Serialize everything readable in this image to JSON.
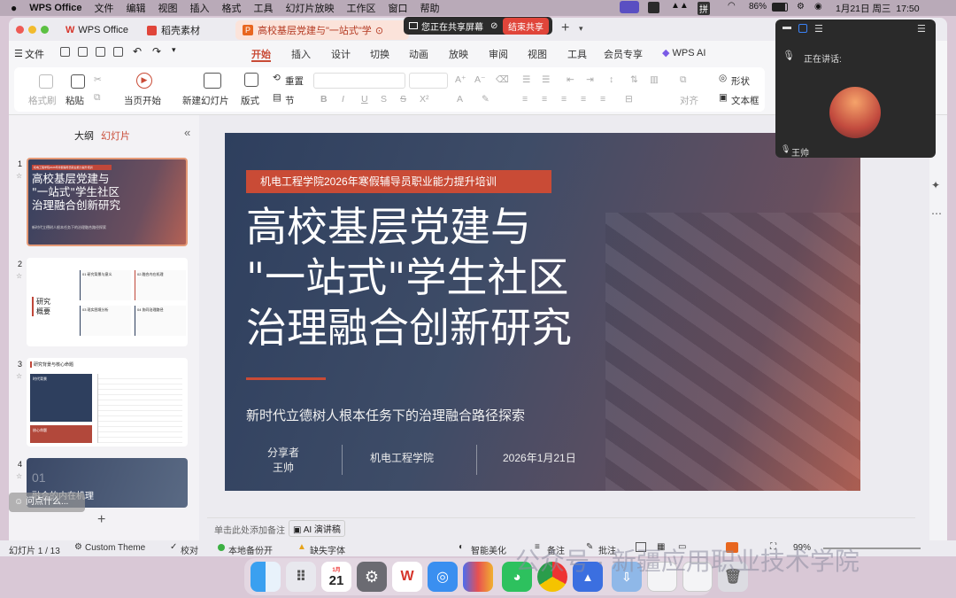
{
  "menubar": {
    "app": "WPS Office",
    "items": [
      "文件",
      "编辑",
      "视图",
      "插入",
      "格式",
      "工具",
      "幻灯片放映",
      "工作区",
      "窗口",
      "帮助"
    ],
    "ime": "拼",
    "battery": "86%",
    "datetime": "1月21日 周三  17:50"
  },
  "share_bar": {
    "text": "您正在共享屏幕",
    "stop": "结束共享"
  },
  "tabs": [
    {
      "label": "WPS Office"
    },
    {
      "label": "稻壳素材"
    },
    {
      "label": "高校基层党建与\"一站式\"学"
    }
  ],
  "ribbon": {
    "file": "文件",
    "tabs": [
      "开始",
      "插入",
      "设计",
      "切换",
      "动画",
      "放映",
      "审阅",
      "视图",
      "工具",
      "会员专享",
      "WPS AI"
    ],
    "active_tab": "开始",
    "tools": {
      "format_painter": "格式刷",
      "paste": "粘贴",
      "from_current": "当页开始",
      "new_slide": "新建幻灯片",
      "layout": "版式",
      "reset": "重置",
      "section": "节",
      "align": "对齐",
      "shape": "形状",
      "textbox": "文本框"
    }
  },
  "sidebar": {
    "outline": "大纲",
    "slides": "幻灯片",
    "numbers": [
      "1",
      "2",
      "3",
      "4"
    ],
    "t1": {
      "tag": "机电工程学院2026年寒假辅导员职业能力提升培训",
      "title": "高校基层党建与\n\"一站式\"学生社区\n治理融合创新研究",
      "sub": "新时代立德树人根本任务下的治理融合路径探索"
    },
    "t2": {
      "label": "研究\n概要",
      "items": [
        "01 研究背景与意义",
        "02 融合内在机理",
        "03 现实困境分析",
        "04 协同治理路径"
      ]
    },
    "t3": {
      "title": "研究背景与核心命题",
      "card1": "时代背景",
      "card2": "核心命题"
    },
    "t4": {
      "num": "01",
      "title": "融合的内在机理"
    },
    "ask": "问点什么..."
  },
  "slide": {
    "tag": "机电工程学院2026年寒假辅导员职业能力提升培训",
    "title": [
      "高校基层党建与",
      "\"一站式\"学生社区",
      "治理融合创新研究"
    ],
    "subtitle": "新时代立德树人根本任务下的治理融合路径探索",
    "presenter_label": "分享者",
    "presenter": "王帅",
    "org": "机电工程学院",
    "date": "2026年1月21日"
  },
  "notes": {
    "placeholder": "单击此处添加备注",
    "ai": "AI 演讲稿"
  },
  "status": {
    "slide_count": "幻灯片 1 / 13",
    "theme": "Custom Theme",
    "proof": "校对",
    "backup": "本地备份开",
    "missing_font": "缺失字体",
    "beautify": "智能美化",
    "notes": "备注",
    "comment": "批注",
    "zoom": "99%"
  },
  "call": {
    "speaking": "正在讲话:",
    "name": "王帅"
  },
  "dock": {
    "calendar_month": "1月",
    "calendar_day": "21"
  },
  "watermark": "公众号 · 新疆应用职业技术学院",
  "colors": {
    "accent": "#c94b36",
    "tab_active": "#fbe3da",
    "slide_dark": "#2e3f5e"
  }
}
